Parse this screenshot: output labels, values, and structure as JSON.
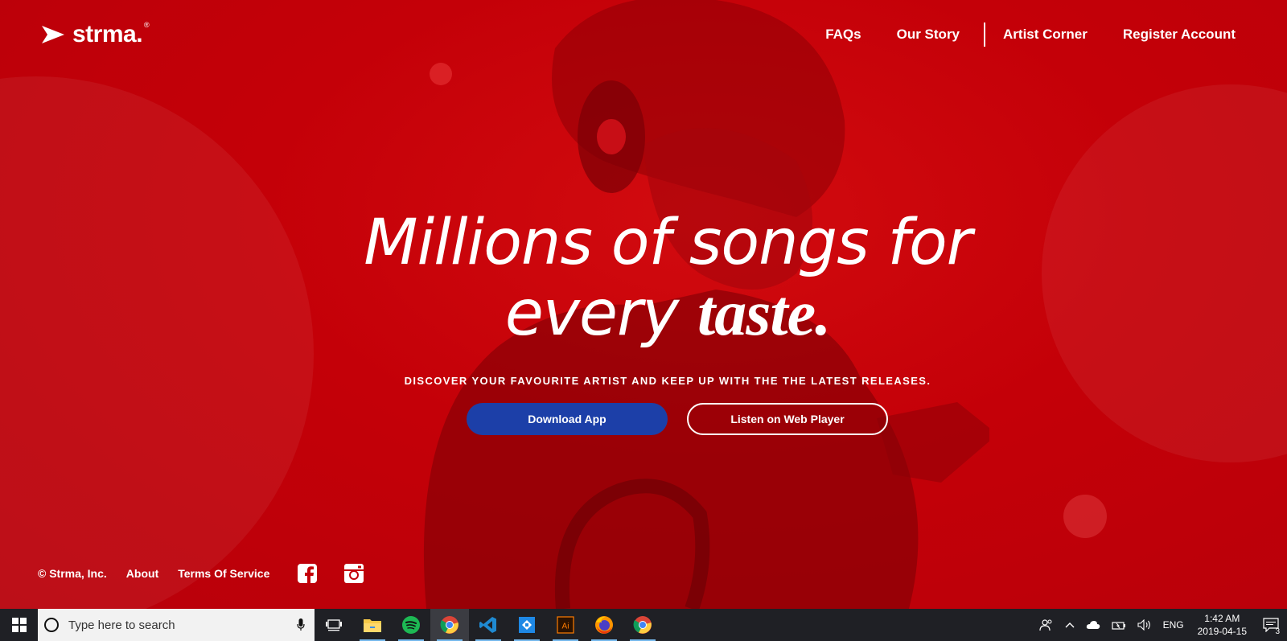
{
  "brand": {
    "name": "strma.",
    "reg": "®"
  },
  "nav": {
    "items": [
      {
        "label": "FAQs"
      },
      {
        "label": "Our Story"
      },
      {
        "label": "Artist Corner"
      },
      {
        "label": "Register Account"
      }
    ]
  },
  "hero": {
    "line1": "Millions of songs for",
    "line2_light": "every ",
    "line2_bold": "taste.",
    "subtitle": "DISCOVER YOUR FAVOURITE ARTIST AND KEEP UP WITH THE THE LATEST RELEASES.",
    "download_label": "Download App",
    "webplayer_label": "Listen on Web Player"
  },
  "footer": {
    "copyright": "© Strma, Inc.",
    "about": "About",
    "terms": "Terms Of Service",
    "social": [
      "facebook-icon",
      "instagram-icon"
    ]
  },
  "colors": {
    "background": "#c40008",
    "download_button": "#1c3fa8",
    "taskbar": "#1f2025"
  },
  "taskbar": {
    "search_placeholder": "Type here to search",
    "apps": [
      "task-view-icon",
      "file-explorer-icon",
      "spotify-icon",
      "chrome-icon",
      "vscode-icon",
      "app-icon",
      "illustrator-icon",
      "firefox-icon",
      "chrome-icon"
    ],
    "language": "ENG",
    "time": "1:42 AM",
    "date": "2019-04-15",
    "notifications": "3"
  }
}
